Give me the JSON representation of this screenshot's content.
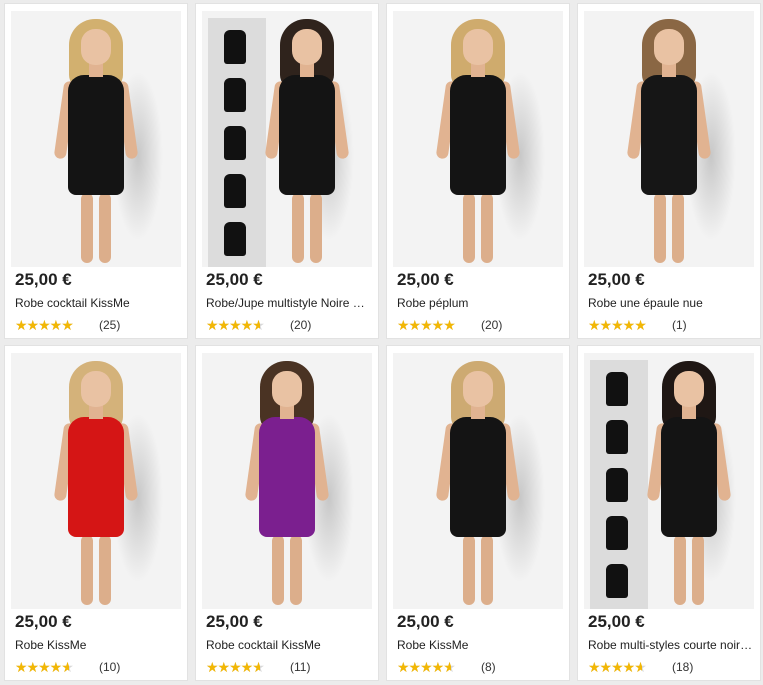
{
  "products": [
    {
      "price": "25,00 €",
      "title": "Robe cocktail KissMe",
      "rating": 4.5,
      "count": "(25)",
      "dress_color": "#141414",
      "hair_color": "#d2b06f",
      "variants": false
    },
    {
      "price": "25,00 €",
      "title": "Robe/Jupe multistyle Noire KissMe",
      "rating": 4.0,
      "count": "(20)",
      "dress_color": "#141414",
      "hair_color": "#2f231c",
      "variants": true
    },
    {
      "price": "25,00 €",
      "title": "Robe péplum",
      "rating": 5.0,
      "count": "(20)",
      "dress_color": "#141414",
      "hair_color": "#cfab6d",
      "variants": false
    },
    {
      "price": "25,00 €",
      "title": "Robe une épaule nue",
      "rating": 5.0,
      "count": "(1)",
      "dress_color": "#161616",
      "hair_color": "#8a6744",
      "variants": false
    },
    {
      "price": "25,00 €",
      "title": "Robe KissMe",
      "rating": 4.0,
      "count": "(10)",
      "dress_color": "#d51515",
      "hair_color": "#d4b27a",
      "variants": false
    },
    {
      "price": "25,00 €",
      "title": "Robe cocktail KissMe",
      "rating": 4.0,
      "count": "(11)",
      "dress_color": "#7b1f8f",
      "hair_color": "#4a3323",
      "variants": false
    },
    {
      "price": "25,00 €",
      "title": "Robe KissMe",
      "rating": 4.0,
      "count": "(8)",
      "dress_color": "#141414",
      "hair_color": "#cdaa72",
      "variants": false
    },
    {
      "price": "25,00 €",
      "title": "Robe multi-styles courte noire KissMe",
      "rating": 4.0,
      "count": "(18)",
      "dress_color": "#141414",
      "hair_color": "#1f1714",
      "variants": true
    }
  ],
  "star_icon": "star-icon"
}
